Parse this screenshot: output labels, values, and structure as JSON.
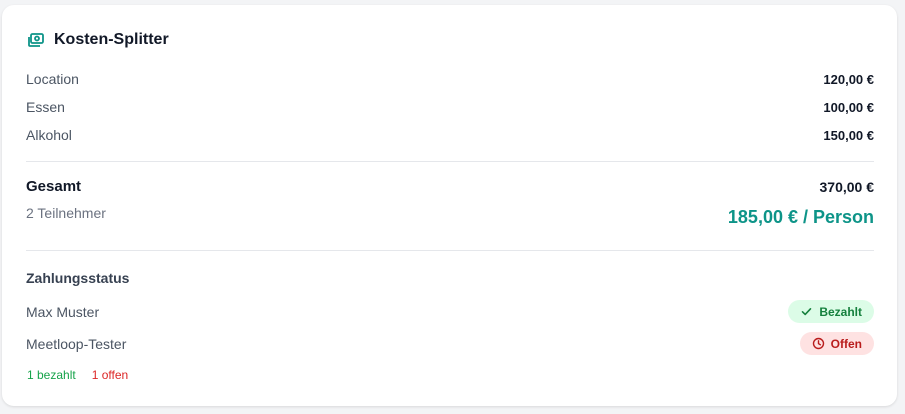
{
  "header": {
    "icon": "cash-icon",
    "title": "Kosten-Splitter"
  },
  "costs": [
    {
      "label": "Location",
      "amount": "120,00 €"
    },
    {
      "label": "Essen",
      "amount": "100,00 €"
    },
    {
      "label": "Alkohol",
      "amount": "150,00 €"
    }
  ],
  "total": {
    "label": "Gesamt",
    "amount": "370,00 €",
    "participants": "2 Teilnehmer",
    "per_person": "185,00 € / Person"
  },
  "payment": {
    "title": "Zahlungsstatus",
    "people": [
      {
        "name": "Max Muster",
        "status": "Bezahlt",
        "status_icon": "check-icon"
      },
      {
        "name": "Meetloop-Tester",
        "status": "Offen",
        "status_icon": "clock-icon"
      }
    ],
    "summary_paid": "1 bezahlt",
    "summary_open": "1 offen"
  },
  "colors": {
    "accent": "#0d9488",
    "paid_bg": "#dcfce7",
    "paid_text": "#15803d",
    "open_bg": "#fee2e2",
    "open_text": "#b91c1c"
  }
}
